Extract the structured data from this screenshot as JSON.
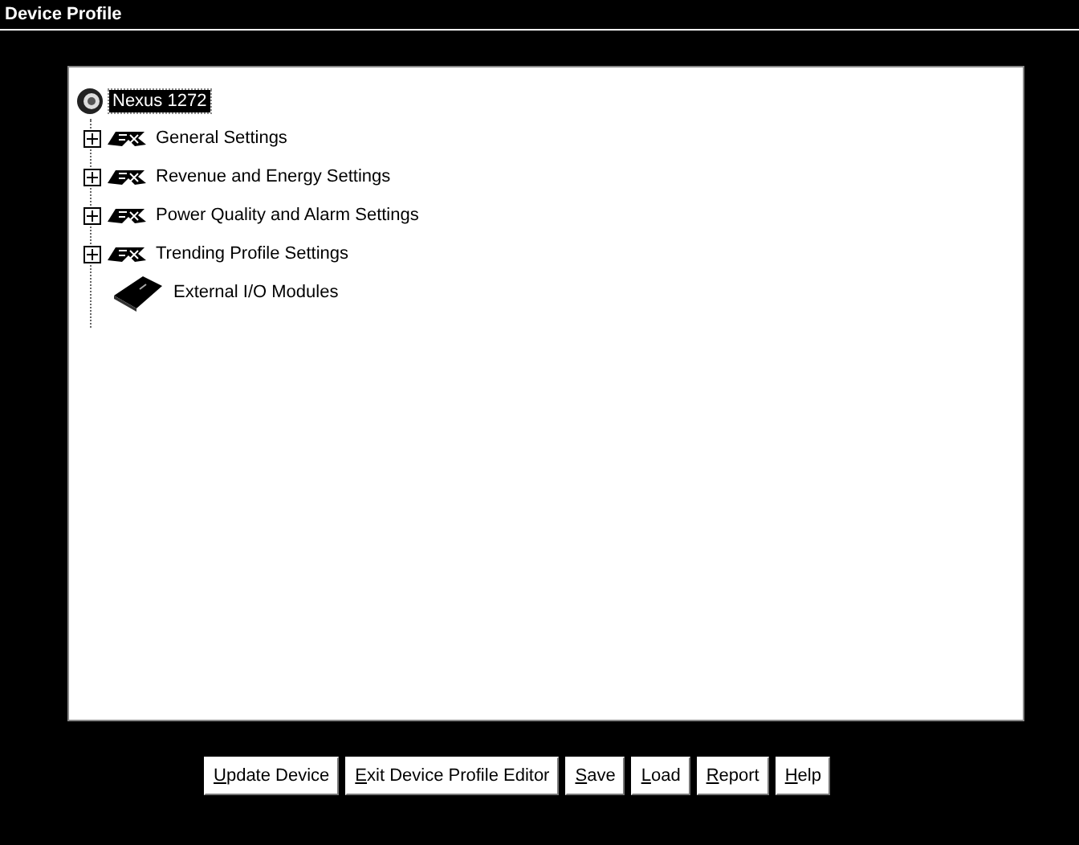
{
  "window": {
    "title": "Device Profile"
  },
  "tree": {
    "label": "Nexus 1272",
    "selected": true,
    "children": [
      {
        "label": "General Settings",
        "kind": "ext",
        "expanded": false
      },
      {
        "label": "Revenue and Energy Settings",
        "kind": "ext",
        "expanded": false
      },
      {
        "label": "Power Quality and Alarm Settings",
        "kind": "ext",
        "expanded": false
      },
      {
        "label": "Trending Profile Settings",
        "kind": "ext",
        "expanded": false
      },
      {
        "label": "External I/O Modules",
        "kind": "module"
      }
    ]
  },
  "buttons": [
    {
      "key": "U",
      "rest": "pdate Device"
    },
    {
      "key": "E",
      "rest": "xit Device Profile Editor"
    },
    {
      "key": "S",
      "rest": "ave"
    },
    {
      "key": "L",
      "rest": "oad"
    },
    {
      "key": "R",
      "rest": "eport"
    },
    {
      "key": "H",
      "rest": "elp"
    }
  ]
}
